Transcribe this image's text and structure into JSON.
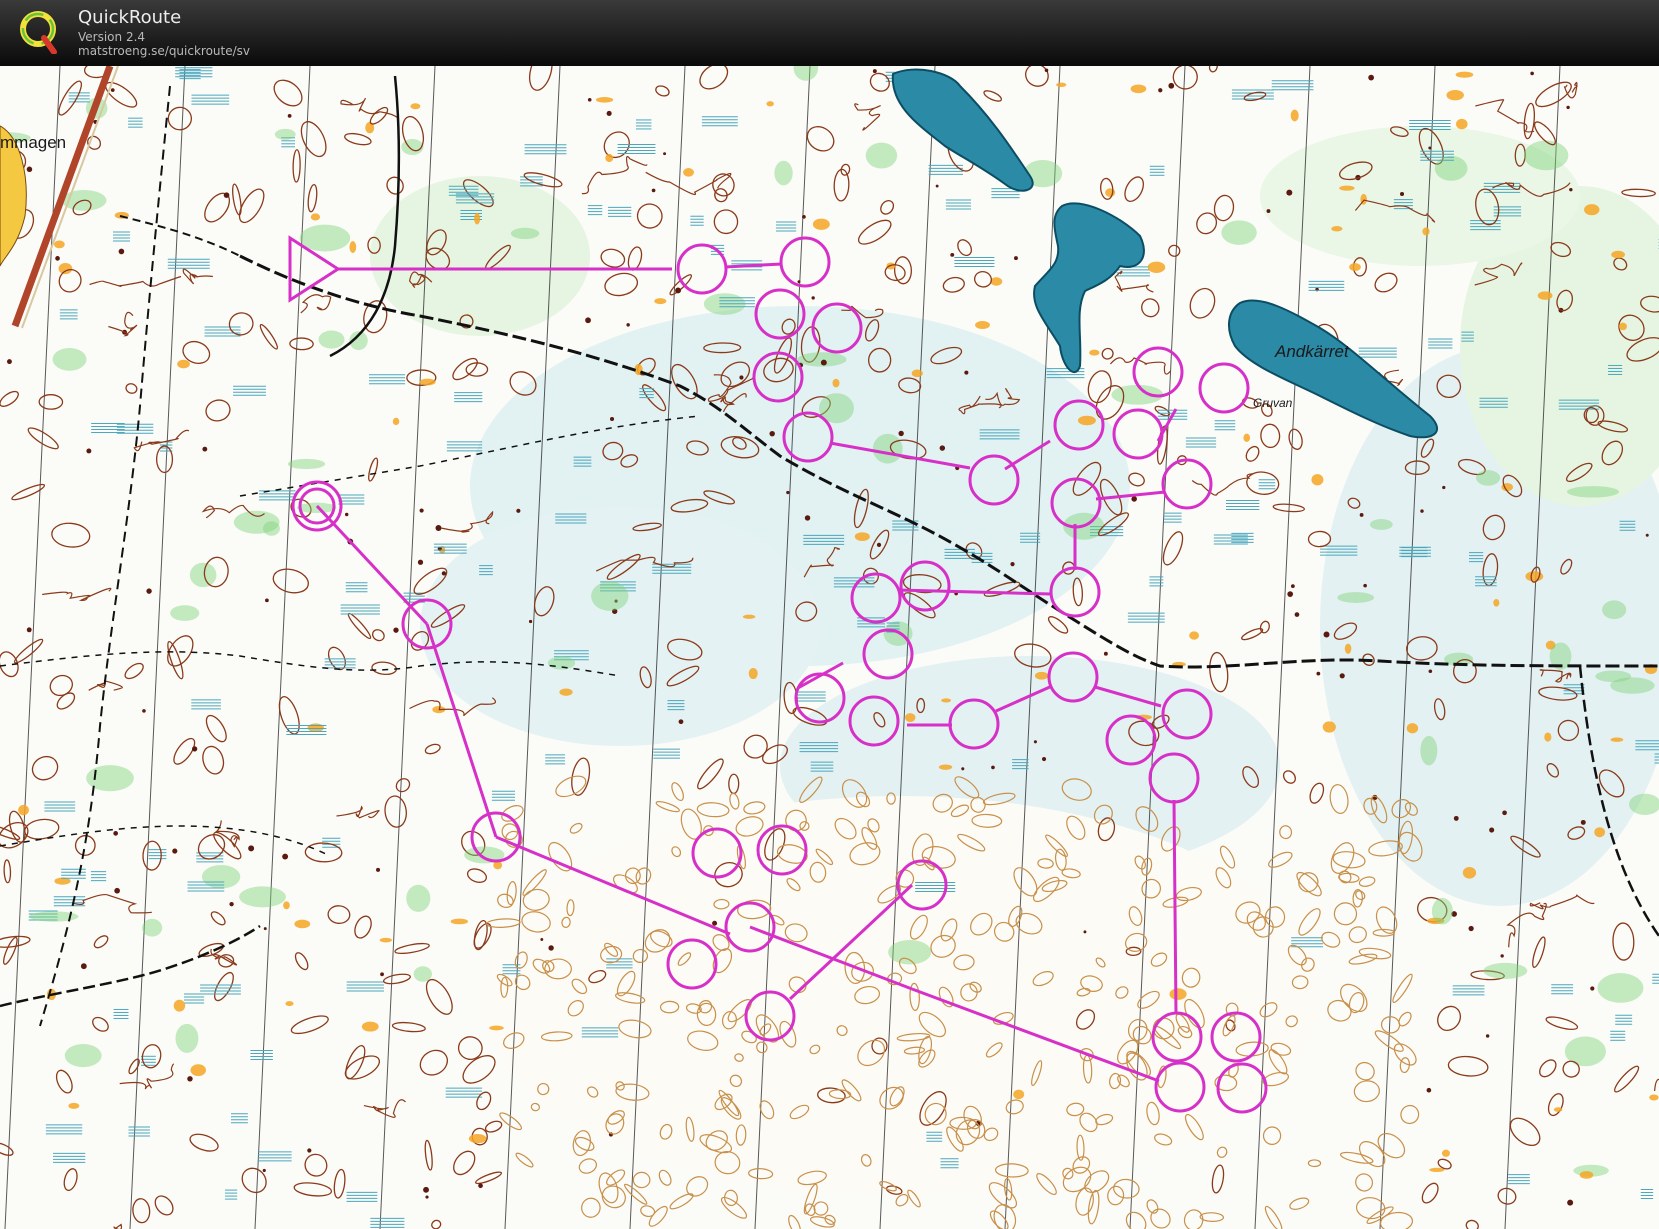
{
  "header": {
    "app_name": "QuickRoute",
    "version": "Version 2.4",
    "url": "matstroeng.se/quickroute/sv"
  },
  "map": {
    "place_labels": {
      "lake": "Andkärret",
      "mine": "Gruvan",
      "edge": "mmagen"
    }
  },
  "colors": {
    "course": "#d630c8",
    "water": "#1f7f9a",
    "contour": "#8a3a1a",
    "marsh": "#4aa7bd",
    "open_yellow": "#f5a623",
    "green": "#7fd37a",
    "sand_contour": "#c8904a"
  },
  "icons": [
    "quickroute-logo-icon",
    "start-triangle-icon"
  ]
}
